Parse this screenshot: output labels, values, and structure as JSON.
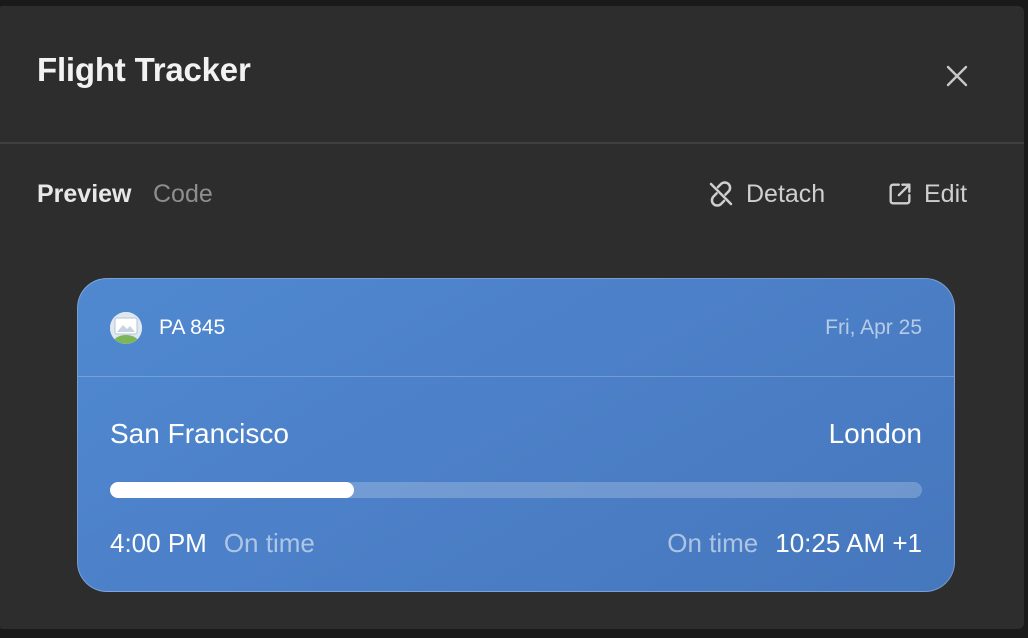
{
  "header": {
    "title": "Flight Tracker",
    "close_icon": "close-icon"
  },
  "toolbar": {
    "tabs": [
      {
        "label": "Preview",
        "active": true
      },
      {
        "label": "Code",
        "active": false
      }
    ],
    "actions": [
      {
        "label": "Detach",
        "icon": "unlink-icon"
      },
      {
        "label": "Edit",
        "icon": "external-link-icon"
      }
    ]
  },
  "flight": {
    "airline_icon": "airline-logo-icon",
    "number": "PA 845",
    "date": "Fri, Apr 25",
    "origin": {
      "city": "San Francisco",
      "time": "4:00 PM",
      "status": "On time"
    },
    "destination": {
      "city": "London",
      "time": "10:25 AM +1",
      "status": "On time"
    },
    "progress": 0.3
  },
  "colors": {
    "panel_bg": "#2d2d2d",
    "card_accent": "#4c80c8",
    "progress_fill": "#ffffff"
  }
}
